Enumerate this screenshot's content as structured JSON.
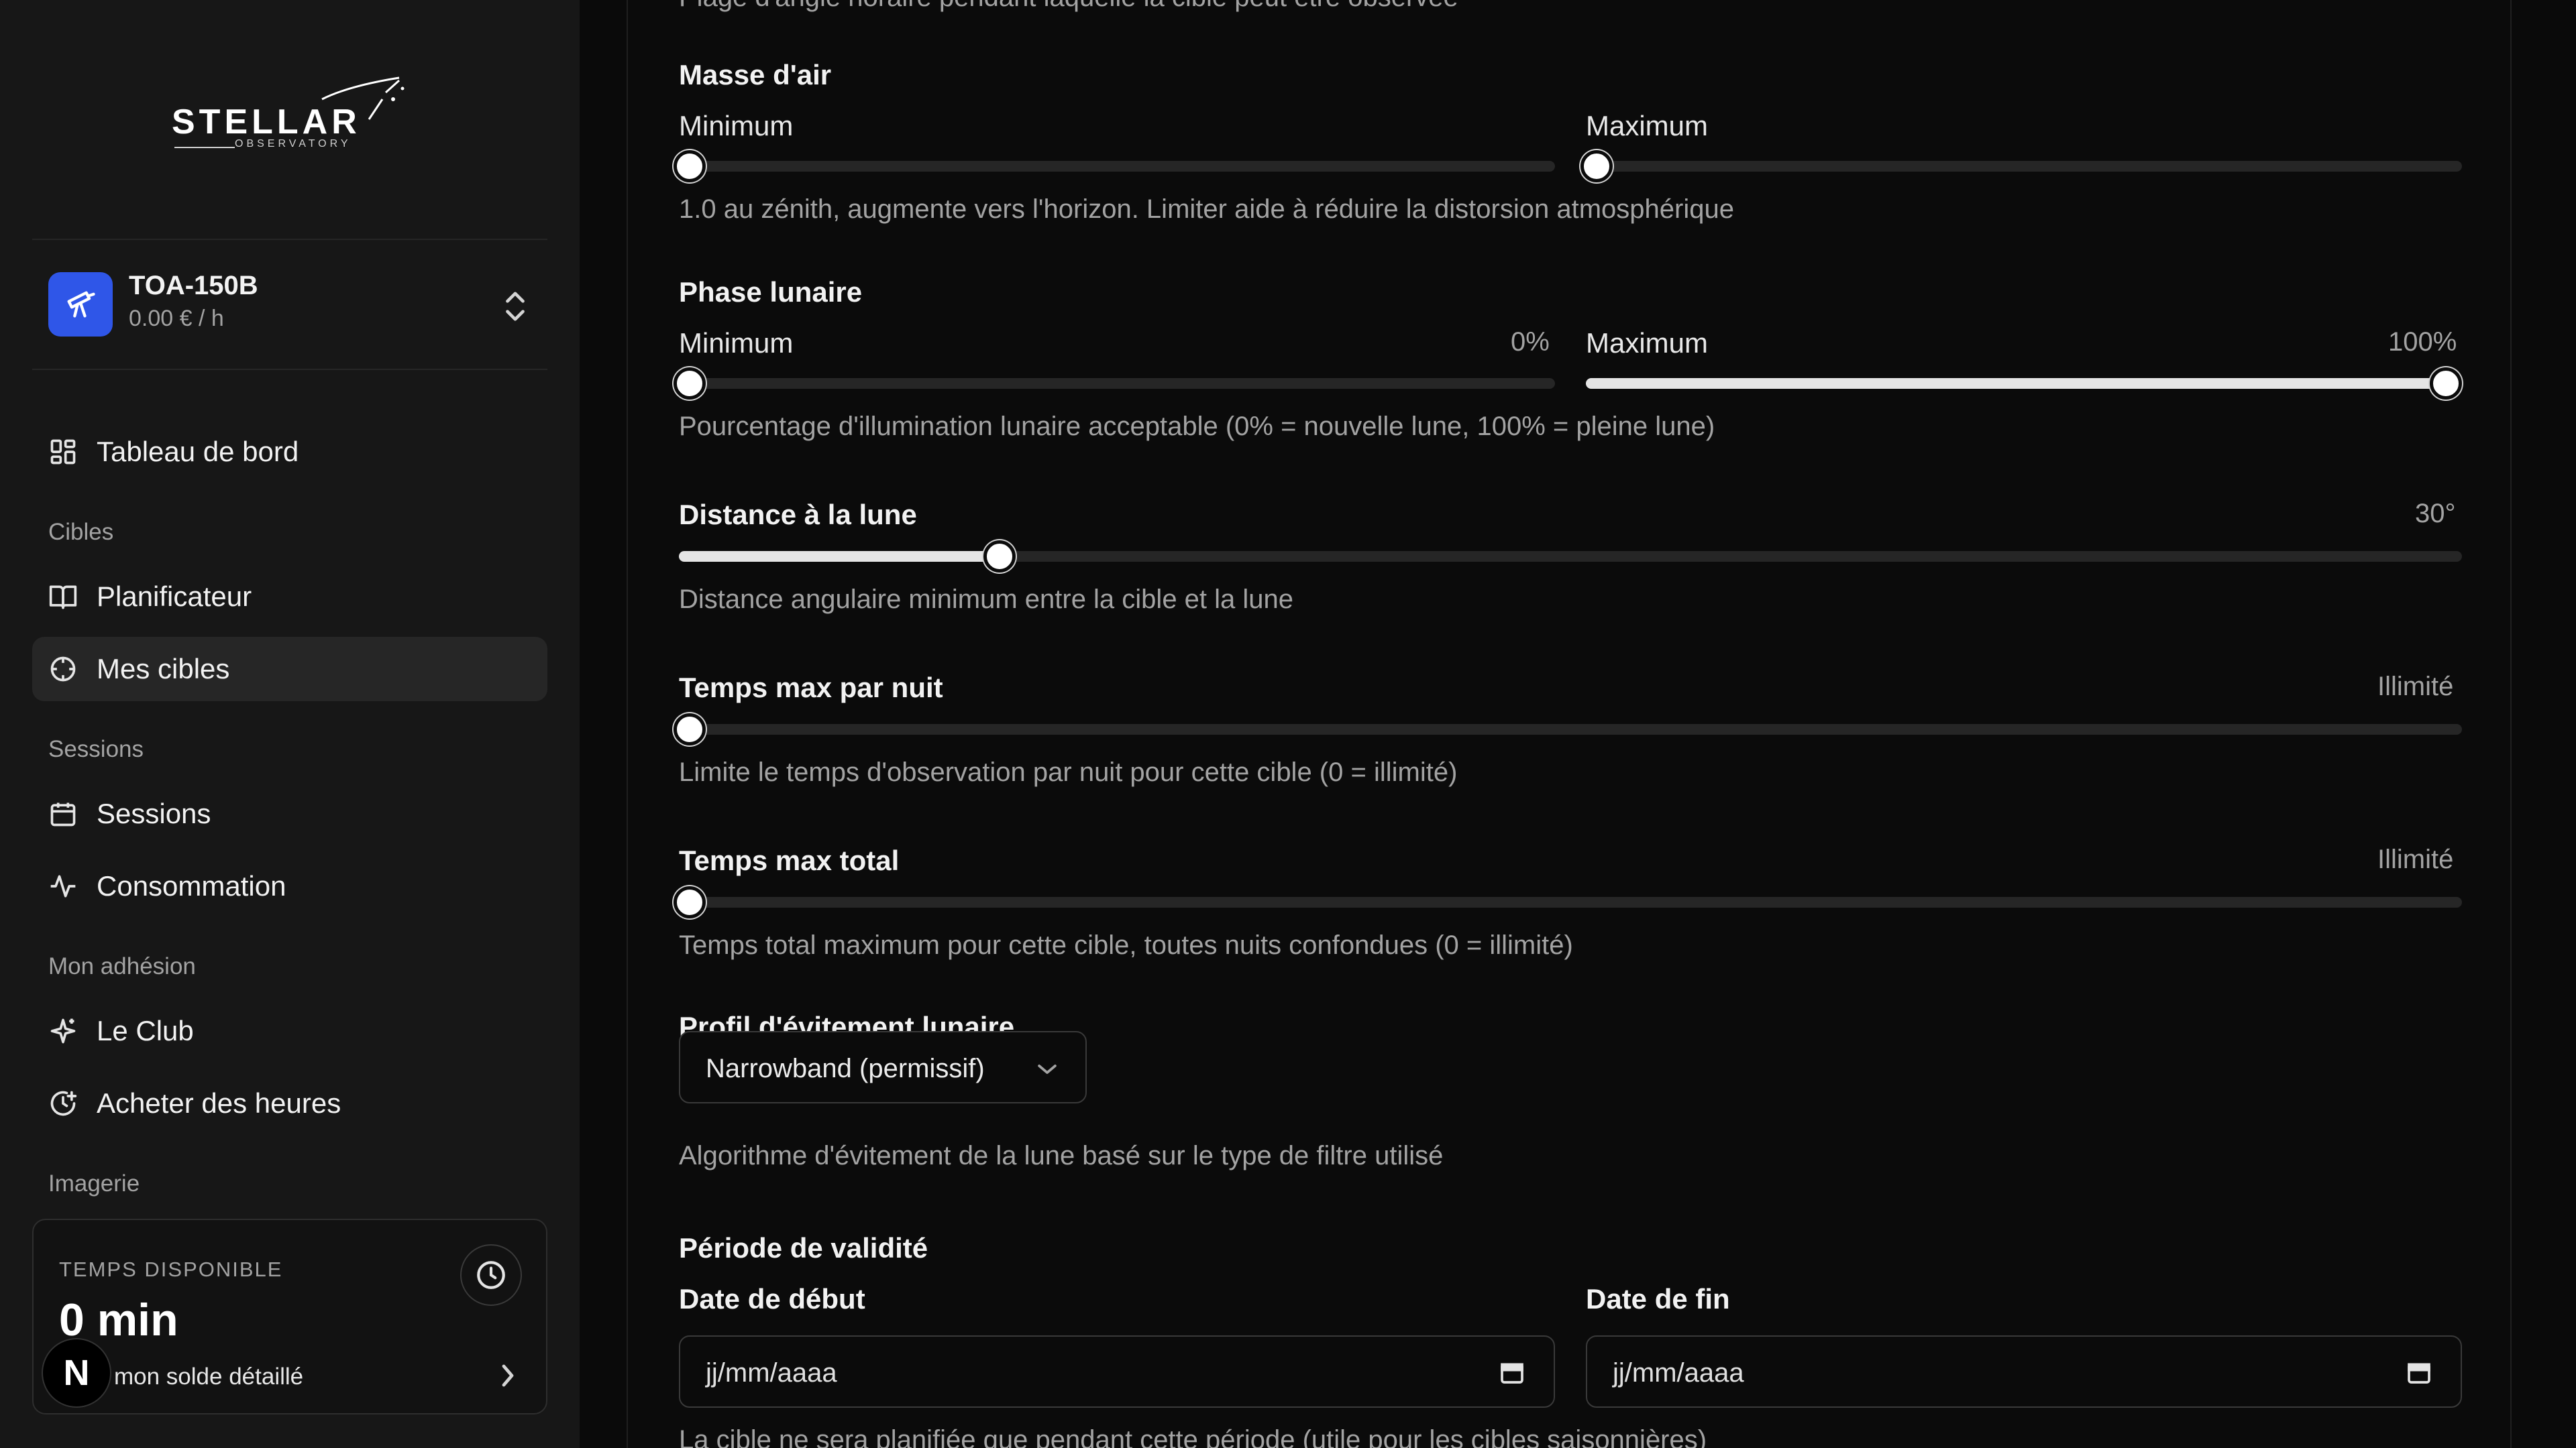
{
  "sidebar": {
    "logo": {
      "word": "STELLAR",
      "sub": "OBSERVATORY"
    },
    "device": {
      "name": "TOA-150B",
      "price": "0.00 € / h"
    },
    "nav": {
      "dashboard": "Tableau de bord",
      "section_targets": "Cibles",
      "planner": "Planificateur",
      "my_targets": "Mes cibles",
      "section_sessions": "Sessions",
      "sessions": "Sessions",
      "consumption": "Consommation",
      "section_membership": "Mon adhésion",
      "club": "Le Club",
      "buy_hours": "Acheter des heures",
      "section_imaging": "Imagerie"
    },
    "time_card": {
      "label": "TEMPS DISPONIBLE",
      "value": "0 min",
      "link": "mon solde détaillé"
    },
    "badge": "N"
  },
  "main": {
    "top_help_partial": "Plage d'angle horaire pendant laquelle la cible peut être observée",
    "airmass": {
      "title": "Masse d'air",
      "min_label": "Minimum",
      "max_label": "Maximum",
      "min_value": 0,
      "max_value": 0,
      "help": "1.0 au zénith, augmente vers l'horizon. Limiter aide à réduire la distorsion atmosphérique"
    },
    "moon_phase": {
      "title": "Phase lunaire",
      "min_label": "Minimum",
      "min_text": "0%",
      "min_value": 0,
      "max_label": "Maximum",
      "max_text": "100%",
      "max_value": 1.0,
      "help": "Pourcentage d'illumination lunaire acceptable (0% = nouvelle lune, 100% = pleine lune)"
    },
    "moon_distance": {
      "title": "Distance à la lune",
      "value_text": "30°",
      "value": 0.18,
      "help": "Distance angulaire minimum entre la cible et la lune"
    },
    "max_per_night": {
      "title": "Temps max par nuit",
      "value_text": "Illimité",
      "value": 0,
      "help": "Limite le temps d'observation par nuit pour cette cible (0 = illimité)"
    },
    "max_total": {
      "title": "Temps max total",
      "value_text": "Illimité",
      "value": 0,
      "help": "Temps total maximum pour cette cible, toutes nuits confondues (0 = illimité)"
    },
    "avoidance": {
      "title": "Profil d'évitement lunaire",
      "selected": "Narrowband (permissif)",
      "help": "Algorithme d'évitement de la lune basé sur le type de filtre utilisé"
    },
    "validity": {
      "title": "Période de validité",
      "start_label": "Date de début",
      "start_placeholder": "jj/mm/aaaa",
      "end_label": "Date de fin",
      "end_placeholder": "jj/mm/aaaa",
      "help_partial": "La cible ne sera planifiée que pendant cette période (utile pour les cibles saisonnières)"
    }
  },
  "colors": {
    "accent": "#2f56e8",
    "bg": "#0b0b0b",
    "sidebar": "#171717",
    "muted": "#a3a3a3"
  }
}
